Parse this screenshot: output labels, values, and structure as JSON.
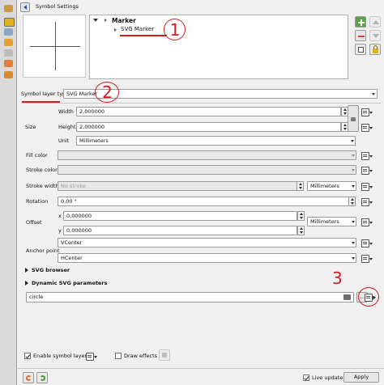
{
  "window": {
    "title": "Symbol Settings"
  },
  "tree": {
    "items": [
      {
        "label": "Marker"
      },
      {
        "label": "SVG Marker"
      }
    ]
  },
  "annotations": {
    "one": "1",
    "two": "2",
    "three": "3"
  },
  "symbol_layer": {
    "label": "Symbol layer type",
    "value": "SVG Marker"
  },
  "size": {
    "group_label": "Size",
    "width_label": "Width",
    "width_value": "2,000000",
    "height_label": "Height",
    "height_value": "2,000000",
    "unit_label": "Unit",
    "unit_value": "Millimeters"
  },
  "fill_color": {
    "label": "Fill color"
  },
  "stroke_color": {
    "label": "Stroke color"
  },
  "stroke_width": {
    "label": "Stroke width",
    "value": "No stroke",
    "unit_value": "Millimeters"
  },
  "rotation": {
    "label": "Rotation",
    "value": "0,00 °"
  },
  "offset": {
    "label": "Offset",
    "x_label": "x",
    "x_value": "0,000000",
    "y_label": "y",
    "y_value": "0,000000",
    "unit_value": "Millimeters"
  },
  "anchor": {
    "label": "Anchor point",
    "vertical": "VCenter",
    "horizontal": "HCenter"
  },
  "svg_browser": {
    "label": "SVG browser"
  },
  "dynamic_svg": {
    "label": "Dynamic SVG parameters"
  },
  "svg_path": {
    "value": "circle",
    "browse_label": "..."
  },
  "bottom": {
    "enable_label": "Enable symbol layer",
    "draw_effects_label": "Draw effects",
    "live_update_label": "Live update",
    "apply_label": "Apply"
  },
  "colors": {
    "accent_green": "#56a744",
    "annotation_red": "#d01c1c",
    "toolbar_gold": "#e1b322"
  }
}
